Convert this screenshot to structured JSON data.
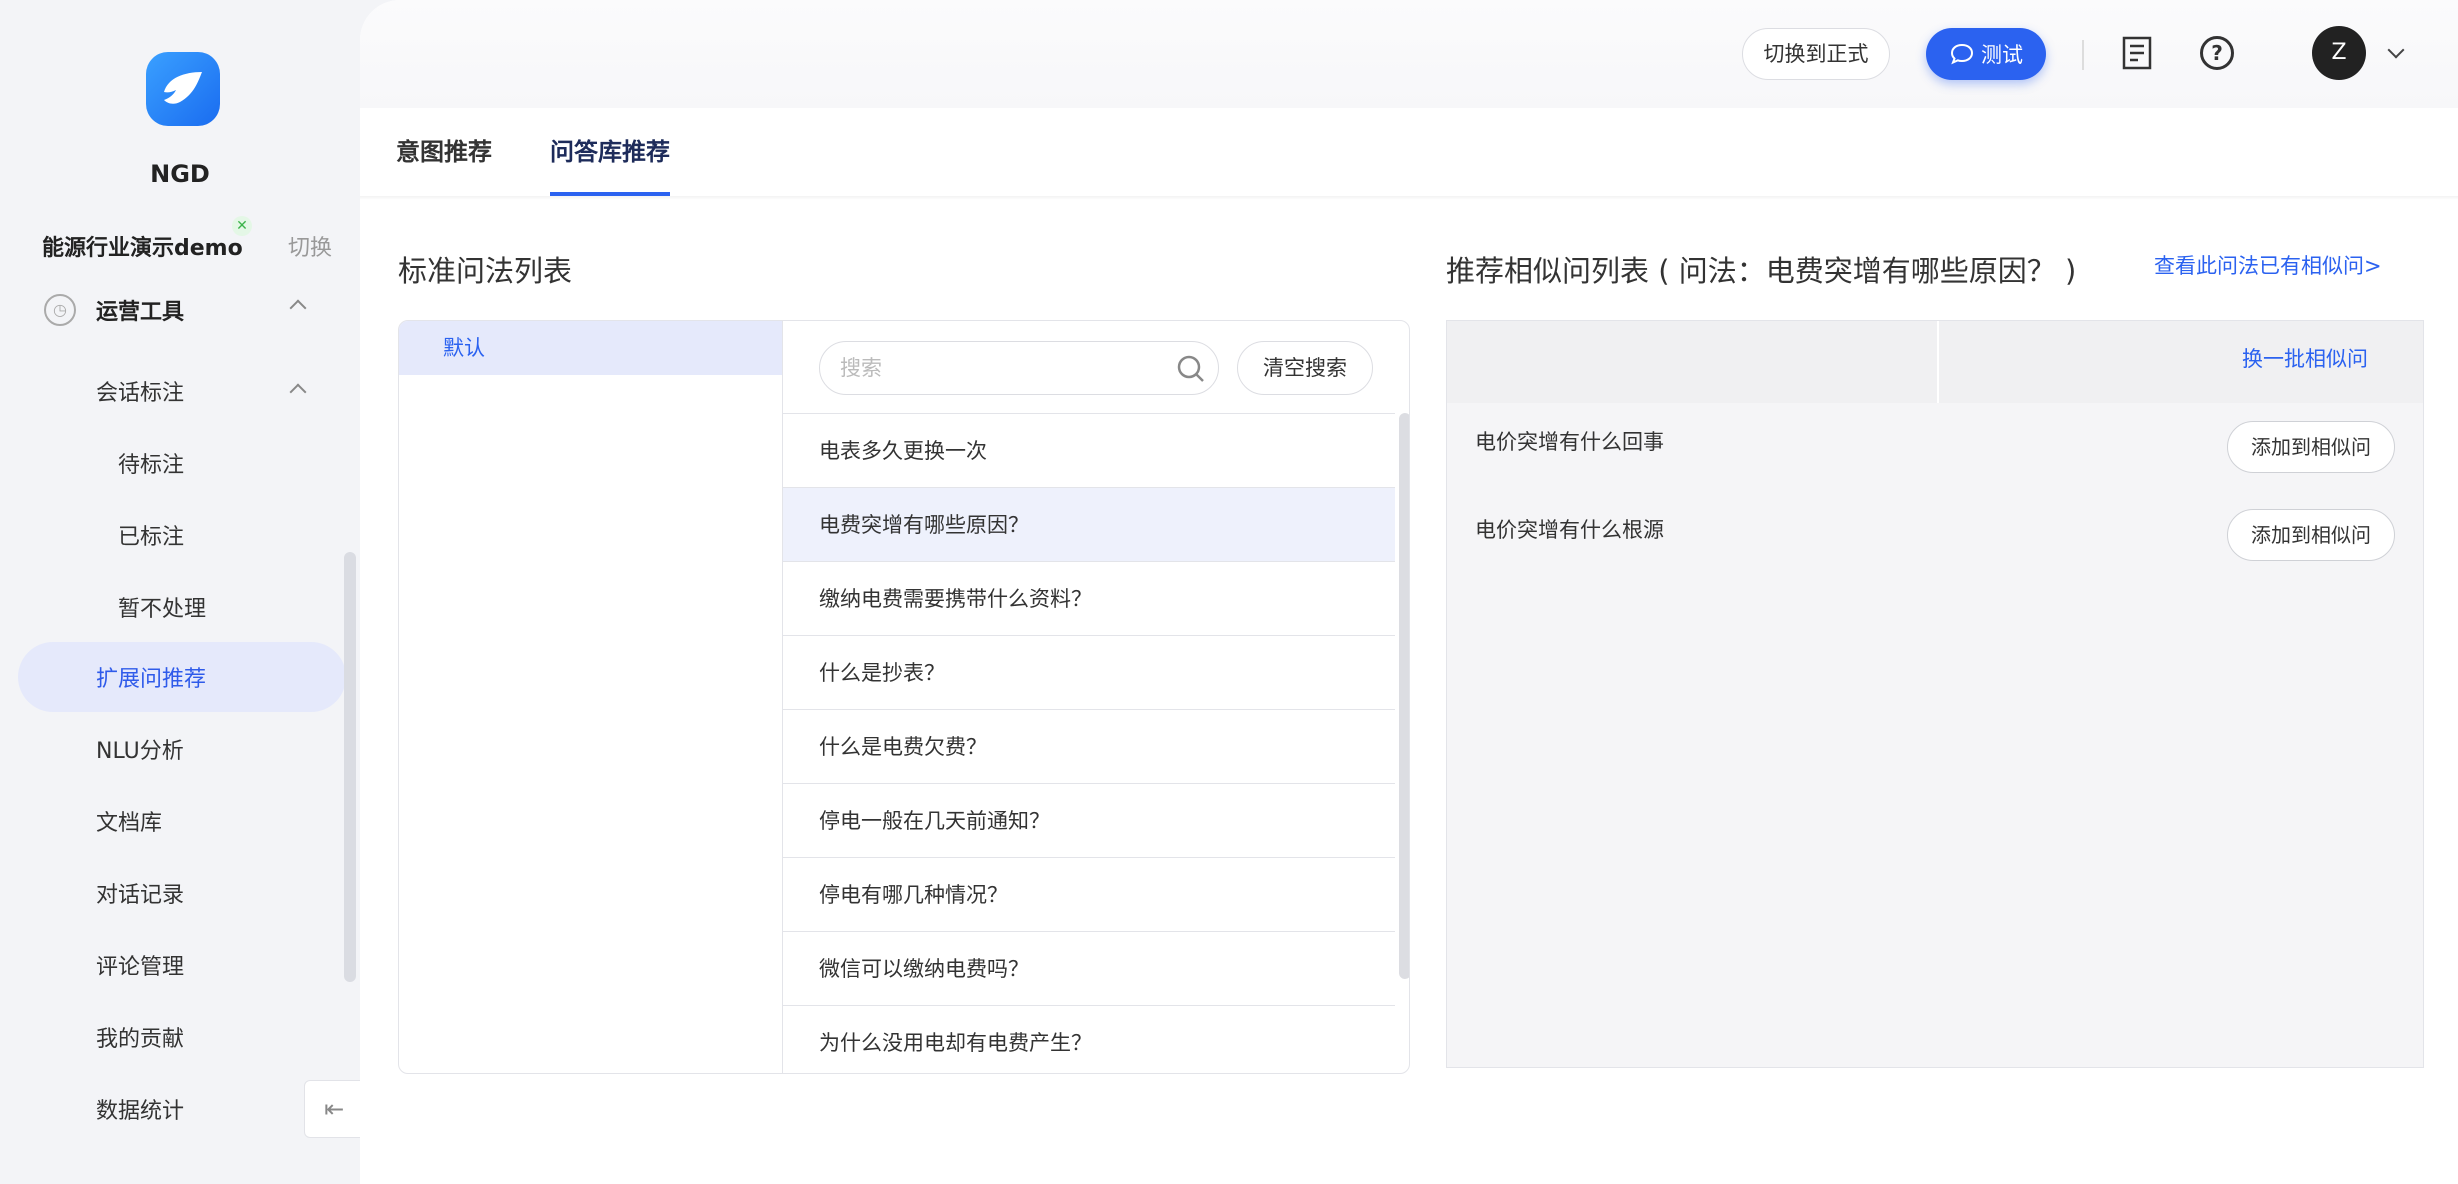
{
  "sidebar": {
    "brand": "NGD",
    "project": "能源行业演示demo",
    "project_badge": "✕",
    "switch_label": "切换",
    "group_label": "运营工具",
    "session_label": "会话标注",
    "items": [
      {
        "label": "待标注"
      },
      {
        "label": "已标注"
      },
      {
        "label": "暂不处理"
      },
      {
        "label": "扩展问推荐",
        "active": true
      },
      {
        "label": "NLU分析"
      },
      {
        "label": "文档库"
      },
      {
        "label": "对话记录"
      },
      {
        "label": "评论管理"
      },
      {
        "label": "我的贡献"
      },
      {
        "label": "数据统计"
      }
    ]
  },
  "topbar": {
    "switch_button": "切换到正式",
    "test_button": "测试",
    "avatar_letter": "Z"
  },
  "tabs": [
    "意图推荐",
    "问答库推荐"
  ],
  "left": {
    "title": "标准问法列表",
    "category": "默认",
    "search_placeholder": "搜索",
    "clear_button": "清空搜索",
    "questions": [
      "电表多久更换一次",
      "电费突增有哪些原因？",
      "缴纳电费需要携带什么资料？",
      "什么是抄表？",
      "什么是电费欠费？",
      "停电一般在几天前通知？",
      "停电有哪几种情况？",
      "微信可以缴纳电费吗？",
      "为什么没用电却有电费产生？"
    ]
  },
  "right": {
    "title": "推荐相似问列表 ( 问法：电费突增有哪些原因？ )",
    "view_link": "查看此问法已有相似问>",
    "refresh_link": "换一批相似问",
    "rows": [
      {
        "text": "电价突增有什么回事",
        "action": "添加到相似问"
      },
      {
        "text": "电价突增有什么根源",
        "action": "添加到相似问"
      }
    ]
  },
  "colors": {
    "accent": "#2b62f0",
    "active_bg": "#e5e9fb"
  }
}
